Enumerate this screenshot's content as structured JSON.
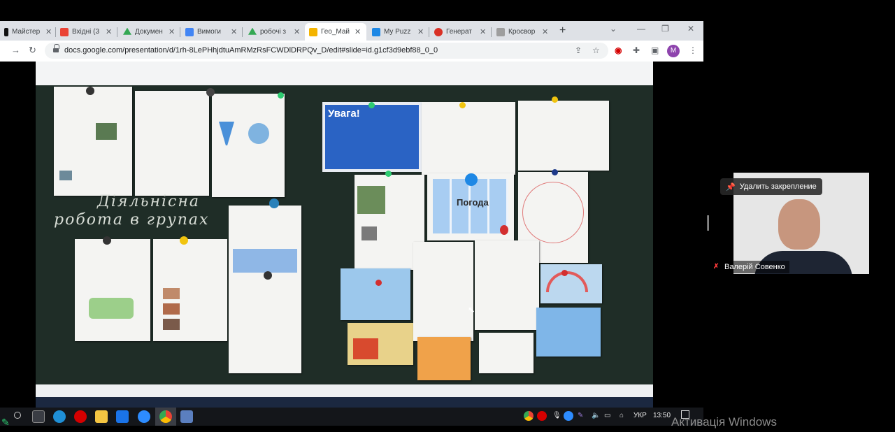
{
  "browser": {
    "tabs": [
      {
        "label": "Майстер",
        "icon": "tiktok-icon",
        "color": "#111111"
      },
      {
        "label": "Вхідні (3",
        "icon": "gmail-icon",
        "color": "#ea4335"
      },
      {
        "label": "Докумен",
        "icon": "google-drive-icon",
        "color": "#34a853"
      },
      {
        "label": "Вимоги",
        "icon": "google-docs-icon",
        "color": "#4285f4"
      },
      {
        "label": "робочі з",
        "icon": "google-drive-icon",
        "color": "#34a853"
      },
      {
        "label": "Гео_Май",
        "icon": "google-slides-icon",
        "color": "#f4b400"
      },
      {
        "label": "My Puzz",
        "icon": "puzzle-icon",
        "color": "#1e88e5"
      },
      {
        "label": "Генерат",
        "icon": "generator-icon",
        "color": "#d93025"
      },
      {
        "label": "Кросвор",
        "icon": "crossword-icon",
        "color": "#9e9e9e"
      }
    ],
    "active_tab_index": 5,
    "url": "docs.google.com/presentation/d/1rh-8LePHhjdtuAmRMzRsFCWDlDRPQv_D/edit#slide=id.g1cf3d9ebf88_0_0",
    "profile_initial": "M",
    "colors": {
      "accent": "#8e44ad",
      "chrome_bg": "#dee1e6"
    }
  },
  "slide": {
    "board_text_line1": "Діяльнісна",
    "board_text_line2": "робота в групах",
    "poster_uvaga_title": "Увага!",
    "poster_pogoda_title": "Погода",
    "board_color": "#1f2d27"
  },
  "meeting": {
    "unpin_label": "Удалить закрепление",
    "participant_name": "Валерій Совенко",
    "mic_muted": true
  },
  "taskbar": {
    "language": "УКР",
    "time": "13:50"
  },
  "windows_watermark": "Активація Windows"
}
